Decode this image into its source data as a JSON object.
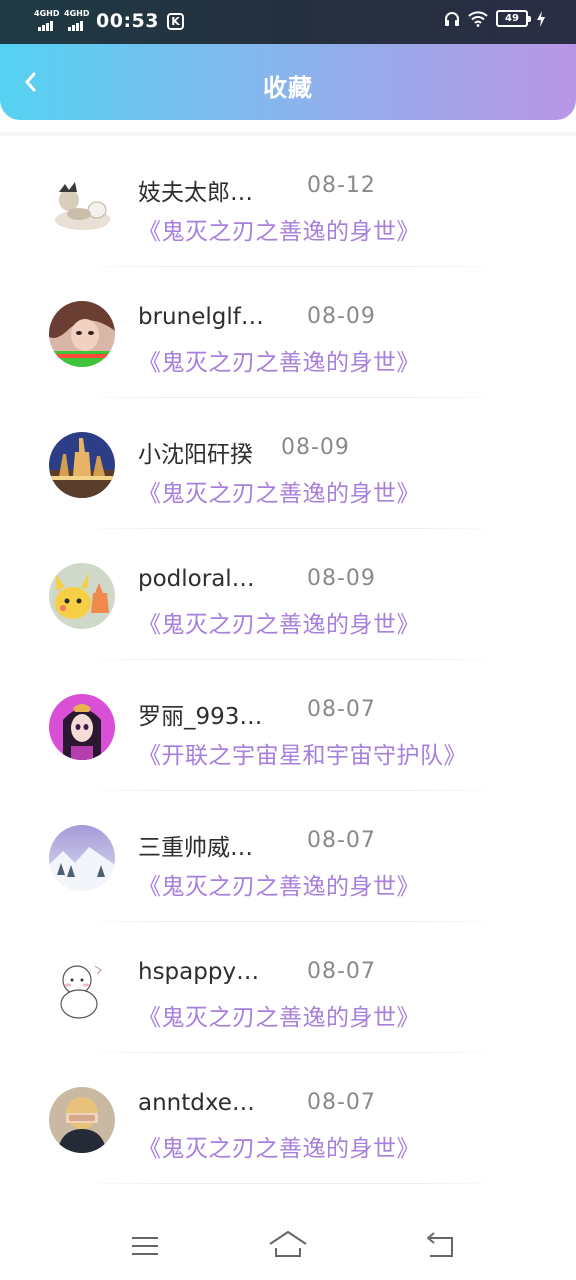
{
  "status_bar": {
    "network_1": "4GHD",
    "network_2": "4GHD",
    "time": "00:53",
    "app_badge": "K",
    "battery": "49"
  },
  "header": {
    "title": "收藏",
    "back_icon": "chevron-left-icon"
  },
  "list": [
    {
      "name": "妓夫太郎…",
      "date": "08-12",
      "work": "《鬼灭之刃之善逸的身世》"
    },
    {
      "name": "brunelglf…",
      "date": "08-09",
      "work": "《鬼灭之刃之善逸的身世》"
    },
    {
      "name": "小沈阳矸揆",
      "date": "08-09",
      "work": "《鬼灭之刃之善逸的身世》"
    },
    {
      "name": "podloral…",
      "date": "08-09",
      "work": "《鬼灭之刃之善逸的身世》"
    },
    {
      "name": "罗丽_993…",
      "date": "08-07",
      "work": "《开联之宇宙星和宇宙守护队》"
    },
    {
      "name": "三重帅威…",
      "date": "08-07",
      "work": "《鬼灭之刃之善逸的身世》"
    },
    {
      "name": "hspappy…",
      "date": "08-07",
      "work": "《鬼灭之刃之善逸的身世》"
    },
    {
      "name": "anntdxe…",
      "date": "08-07",
      "work": "《鬼灭之刃之善逸的身世》"
    }
  ],
  "colors": {
    "header_gradient_start": "#55d2f2",
    "header_gradient_end": "#b996e6",
    "work_title": "#a77fdc",
    "date": "#8a8a8a"
  },
  "nav_bar": {
    "menu_icon": "menu-icon",
    "home_icon": "home-icon",
    "back_icon": "back-icon"
  }
}
